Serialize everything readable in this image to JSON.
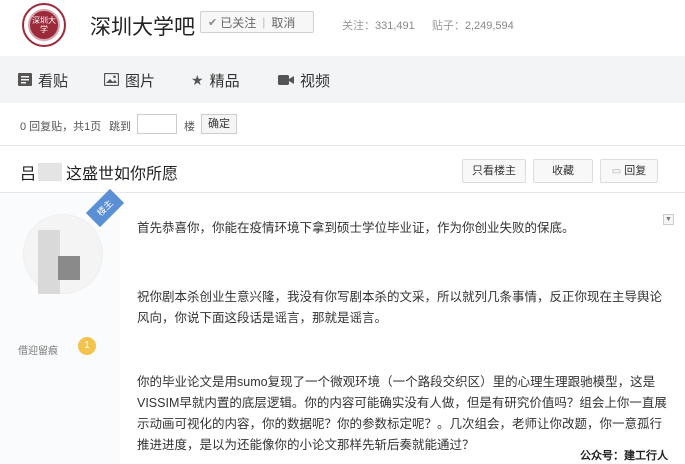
{
  "header": {
    "logo_text": "深圳大学",
    "forum_title": "深圳大学吧",
    "follow_label": "已关注",
    "unfollow_label": "取消",
    "follow_count_label": "关注：",
    "follow_count": "331,491",
    "post_count_label": "贴子：",
    "post_count": "2,249,594"
  },
  "tabs": [
    {
      "label": "看贴",
      "icon": "list-icon"
    },
    {
      "label": "图片",
      "icon": "image-icon"
    },
    {
      "label": "精品",
      "icon": "star-icon"
    },
    {
      "label": "视频",
      "icon": "video-icon"
    }
  ],
  "pager": {
    "summary": "0 回复贴，共1页",
    "jump_label": "跳到",
    "floor_label": "楼",
    "confirm_label": "确定"
  },
  "thread": {
    "title_prefix": "吕",
    "title_suffix": "这盛世如你所愿",
    "only_author_label": "只看楼主",
    "favorite_label": "收藏",
    "reply_label": "回复"
  },
  "post": {
    "ribbon": "楼主",
    "author_name": "借迎留痕",
    "level": "1",
    "paragraphs": [
      "首先恭喜你，你能在疫情环境下拿到硕士学位毕业证，作为你创业失败的保底。",
      "祝你剧本杀创业生意兴隆，我没有你写剧本杀的文采，所以就列几条事情，反正你现在主导舆论风向，你说下面这段话是谣言，那就是谣言。",
      "你的毕业论文是用sumo复现了一个微观环境（一个路段交织区）里的心理生理跟驰模型，这是VISSIM早就内置的底层逻辑。你的内容可能确实没有人做，但是有研究价值吗？组会上你一直展示动画可视化的内容，你的数据呢？你的参数标定呢？。几次组会，老师让你改题，你一意孤行推进进度，是以为还能像你的小论文那样先斩后奏就能通过？"
    ]
  },
  "watermark": "公众号：建工行人"
}
